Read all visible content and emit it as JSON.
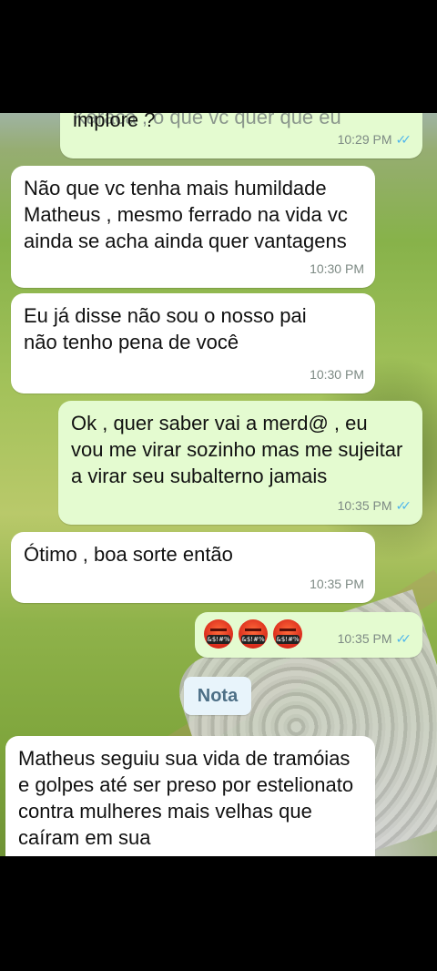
{
  "messages": [
    {
      "id": "m0",
      "direction": "out",
      "text": "Karaca , o que vc quer que eu implore ?",
      "visible_tail": "implore ?",
      "visible_head": "Karaca , o que vc quer que eu",
      "time": "10:29 PM",
      "read": true
    },
    {
      "id": "m1",
      "direction": "in",
      "text": "Não que vc tenha mais humildade Matheus , mesmo ferrado na vida vc ainda se acha ainda quer vantagens",
      "time": "10:30 PM"
    },
    {
      "id": "m2",
      "direction": "in",
      "text": "Eu já disse não sou o nosso pai não tenho pena de você",
      "time": "10:30 PM"
    },
    {
      "id": "m3",
      "direction": "out",
      "text": "Ok , quer saber vai a merd@ , eu vou me virar sozinho mas me sujeitar a virar seu subalterno jamais",
      "time": "10:35 PM",
      "read": true
    },
    {
      "id": "m4",
      "direction": "in",
      "text": "Ótimo , boa sorte então",
      "time": "10:35 PM"
    },
    {
      "id": "m5",
      "direction": "out",
      "emoji_count": 3,
      "emoji_name": "face-with-symbols-on-mouth",
      "emoji_symbol_text": "&$!#%",
      "time": "10:35 PM",
      "read": true
    }
  ],
  "note_label": "Nota",
  "note_message": {
    "text": "Matheus seguiu sua vida de tramóias e golpes até ser preso por estelionato contra mulheres mais velhas que caíram em sua"
  },
  "colors": {
    "incoming_bubble": "#ffffff",
    "outgoing_bubble": "#e4fbd0",
    "read_ticks": "#4fb6ec",
    "note_pill": "#e8f4fb"
  },
  "icons": [
    "double-check-icon"
  ]
}
